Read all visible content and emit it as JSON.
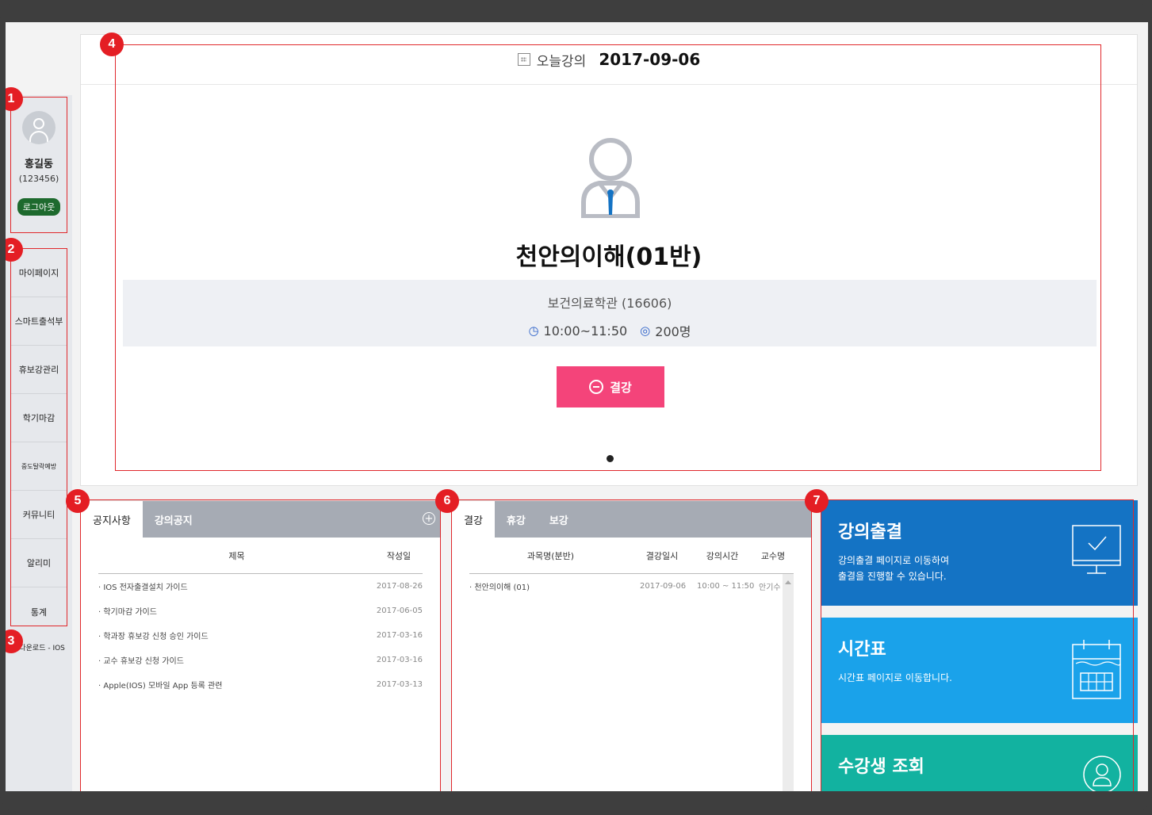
{
  "profile": {
    "name": "홍길동",
    "id": "(123456)",
    "logout_label": "로그아웃"
  },
  "menu": {
    "items": [
      "마이페이지",
      "스마트출석부",
      "휴보강관리",
      "학기마감",
      "중도탈락예방",
      "커뮤니티",
      "알리미",
      "통계"
    ],
    "app_download": "앱다운로드 - IOS"
  },
  "today": {
    "label": "오늘강의",
    "date": "2017-09-06",
    "course": "천안의이해(01반)",
    "department": "보건의료학관 (16606)",
    "time": "10:00~11:50",
    "students": "200명",
    "cancel_label": "결강"
  },
  "notice": {
    "tabs": [
      "공지사항",
      "강의공지"
    ],
    "columns": [
      "제목",
      "작성일"
    ],
    "rows": [
      {
        "title": "· IOS 전자출결설치 가이드",
        "date": "2017-08-26"
      },
      {
        "title": "· 학기마감 가이드",
        "date": "2017-06-05"
      },
      {
        "title": "· 학과장 휴보강 신청 승인 가이드",
        "date": "2017-03-16"
      },
      {
        "title": "· 교수 휴보강 신청 가이드",
        "date": "2017-03-16"
      },
      {
        "title": "· Apple(IOS) 모바일 App 등록 관련",
        "date": "2017-03-13"
      }
    ]
  },
  "absence": {
    "tabs": [
      "결강",
      "휴강",
      "보강"
    ],
    "columns": [
      "과목명(분반)",
      "결강일시",
      "강의시간",
      "교수명"
    ],
    "rows": [
      {
        "course": "· 천안의이해 (01)",
        "date": "2017-09-06",
        "time": "10:00 ~ 11:50",
        "prof": "안기수"
      }
    ]
  },
  "tiles": [
    {
      "title": "강의출결",
      "desc1": "강의출결 페이지로 이동하여",
      "desc2": "출결을 진행할 수 있습니다.",
      "color": "#1473c4",
      "icon": "monitor-check-icon"
    },
    {
      "title": "시간표",
      "desc1": "시간표 페이지로 이동합니다.",
      "desc2": "",
      "color": "#1aa2ea",
      "icon": "calendar-icon"
    },
    {
      "title": "수강생 조회",
      "desc1": "",
      "desc2": "",
      "color": "#12b2a0",
      "icon": "user-circle-icon"
    }
  ],
  "badges": [
    "1",
    "2",
    "3",
    "4",
    "5",
    "6",
    "7"
  ],
  "colors": {
    "annotation": "#e41e24",
    "cancel_button": "#f4447a",
    "logout_button": "#1e6a2e",
    "tabbar": "#a6abb4"
  }
}
